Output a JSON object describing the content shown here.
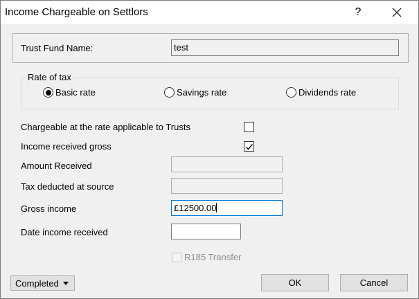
{
  "window": {
    "title": "Income Chargeable on Settlors",
    "help_label": "?"
  },
  "trust": {
    "name_label": "Trust Fund Name:",
    "name_value": "test"
  },
  "rate": {
    "legend": "Rate of tax",
    "options": [
      {
        "label": "Basic rate",
        "selected": true
      },
      {
        "label": "Savings rate",
        "selected": false
      },
      {
        "label": "Dividends rate",
        "selected": false
      }
    ]
  },
  "fields": {
    "chargeable_trusts_label": "Chargeable at the rate applicable to Trusts",
    "chargeable_trusts_checked": false,
    "income_gross_label": "Income received gross",
    "income_gross_checked": true,
    "amount_received_label": "Amount Received",
    "amount_received_value": "",
    "tax_deducted_label": "Tax deducted at source",
    "tax_deducted_value": "",
    "gross_income_label": "Gross income",
    "gross_income_value": "£12500.00",
    "date_received_label": "Date income received",
    "date_received_value": "",
    "r185_label": "R185 Transfer",
    "r185_checked": false
  },
  "footer": {
    "status_label": "Completed",
    "ok_label": "OK",
    "cancel_label": "Cancel"
  },
  "icons": {
    "close": "close-icon",
    "check": "checkmark-icon",
    "dropdown": "chevron-down-icon"
  },
  "colors": {
    "window_bg": "#f0f0f0",
    "focus_border": "#0078d7",
    "button_bg": "#e1e1e1"
  }
}
